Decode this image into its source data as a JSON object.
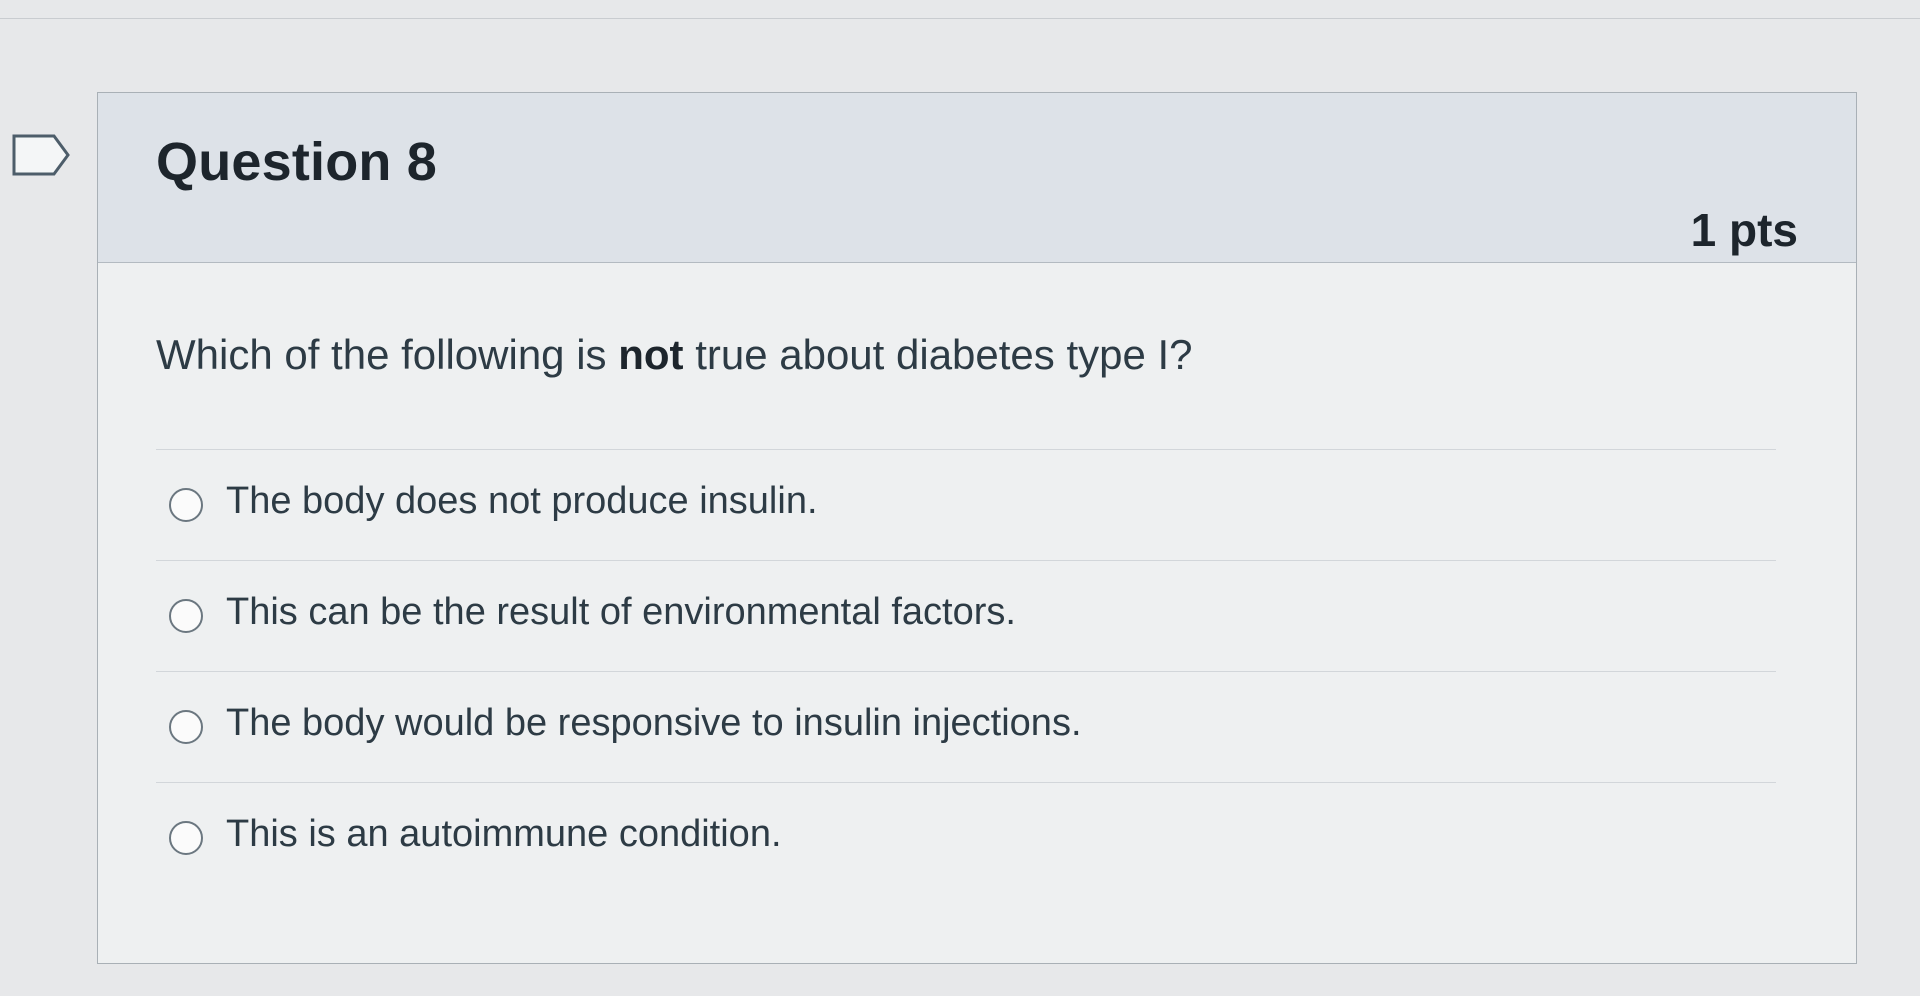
{
  "question": {
    "title": "Question 8",
    "points": "1 pts",
    "text_before": "Which of the following is ",
    "text_emphasis": "not",
    "text_after": " true about diabetes type I?",
    "flag_icon": "flag-outline-icon"
  },
  "answers": [
    "The body does not produce insulin.",
    "This can be the result of environmental factors.",
    "The body would be responsive to insulin injections.",
    "This is an autoimmune condition."
  ]
}
